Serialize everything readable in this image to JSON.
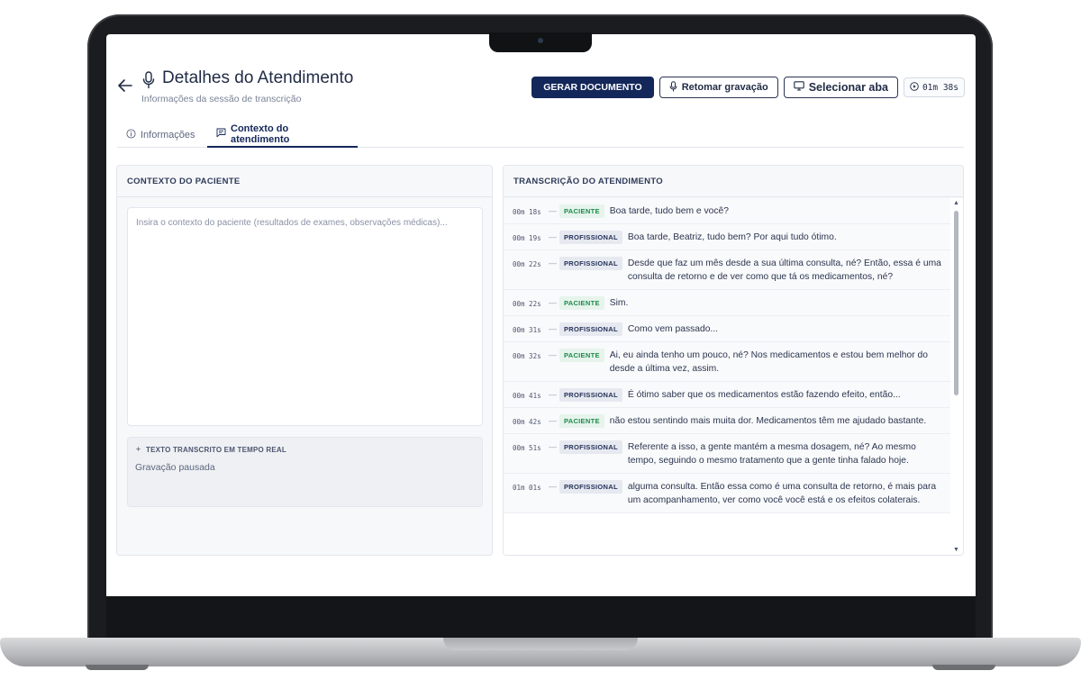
{
  "header": {
    "title": "Detalhes do Atendimento",
    "subtitle": "Informações da sessão de transcrição"
  },
  "actions": {
    "generate_label": "GERAR DOCUMENTO",
    "resume_label": "Retomar gravação",
    "select_tab_label": "Selecionar aba",
    "timer": "01m 38s"
  },
  "tabs": [
    {
      "label": "Informações",
      "icon": "info-icon"
    },
    {
      "label": "Contexto do atendimento",
      "icon": "message-icon"
    }
  ],
  "left_panel": {
    "title": "CONTEXTO DO PACIENTE",
    "placeholder": "Insira o contexto do paciente (resultados de exames, observações médicas)...",
    "realtime_title": "TEXTO TRANSCRITO EM TEMPO REAL",
    "realtime_status": "Gravação pausada"
  },
  "right_panel": {
    "title": "TRANSCRIÇÃO DO ATENDIMENTO",
    "entries": [
      {
        "time": "00m 18s",
        "speaker": "PACIENTE",
        "text": "Boa tarde, tudo bem e você?"
      },
      {
        "time": "00m 19s",
        "speaker": "PROFISSIONAL",
        "text": "Boa tarde, Beatriz, tudo bem? Por aqui tudo ótimo."
      },
      {
        "time": "00m 22s",
        "speaker": "PROFISSIONAL",
        "text": "Desde que faz um mês desde a sua última consulta, né? Então, essa é uma consulta de retorno e de ver como que tá os medicamentos, né?"
      },
      {
        "time": "00m 22s",
        "speaker": "PACIENTE",
        "text": "Sim."
      },
      {
        "time": "00m 31s",
        "speaker": "PROFISSIONAL",
        "text": "Como vem passado..."
      },
      {
        "time": "00m 32s",
        "speaker": "PACIENTE",
        "text": "Ai, eu ainda tenho um pouco, né? Nos medicamentos e estou bem melhor do desde a última vez, assim."
      },
      {
        "time": "00m 41s",
        "speaker": "PROFISSIONAL",
        "text": "É ótimo saber que os medicamentos estão fazendo efeito, então..."
      },
      {
        "time": "00m 42s",
        "speaker": "PACIENTE",
        "text": "não estou sentindo mais muita dor. Medicamentos têm me ajudado bastante."
      },
      {
        "time": "00m 51s",
        "speaker": "PROFISSIONAL",
        "text": "Referente a isso, a gente mantém a mesma dosagem, né? Ao mesmo tempo, seguindo o mesmo tratamento que a gente tinha falado hoje."
      },
      {
        "time": "01m 01s",
        "speaker": "PROFISSIONAL",
        "text": "alguma consulta. Então essa como é uma consulta de retorno, é mais para um acompanhamento, ver como você você está e os efeitos colaterais."
      }
    ]
  },
  "colors": {
    "primary": "#14275a",
    "patient_badge": "#1f8a4c",
    "professional_badge": "#243259"
  }
}
